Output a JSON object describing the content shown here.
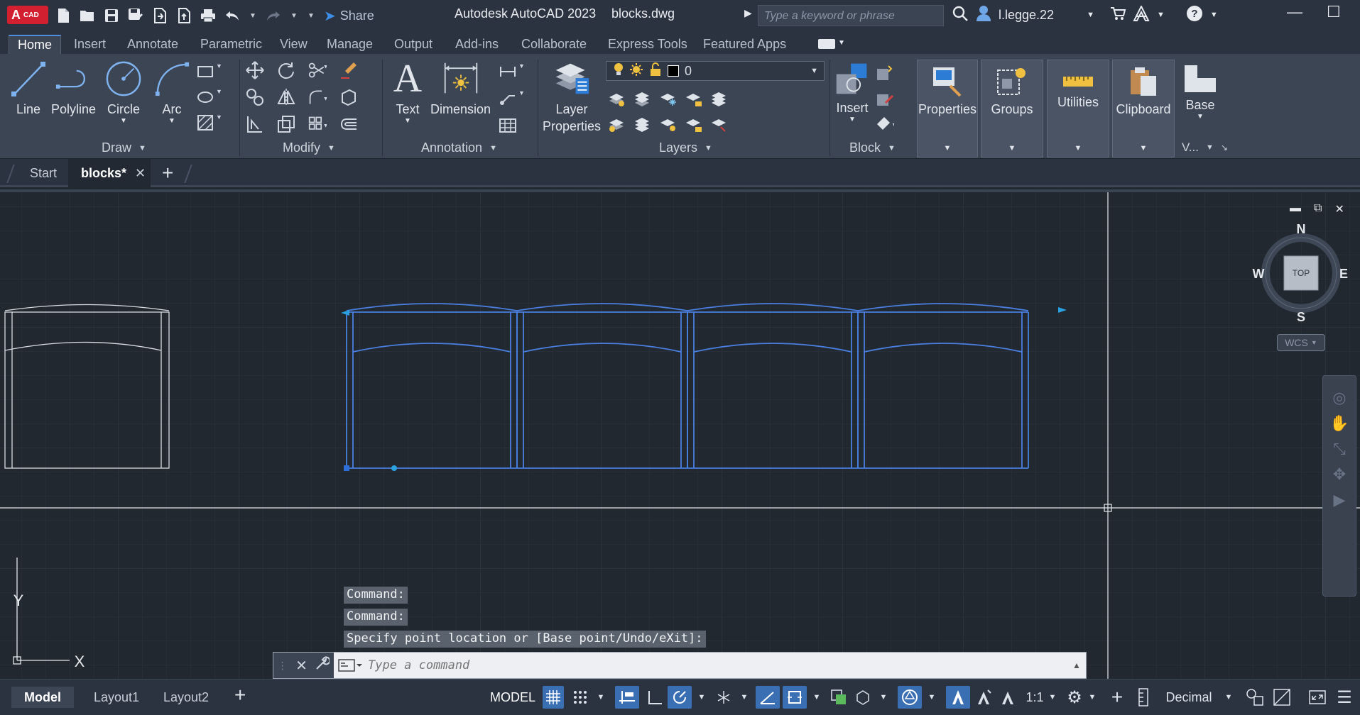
{
  "app": {
    "logo_letter": "A",
    "logo_suffix": "CAD",
    "title": "Autodesk AutoCAD 2023",
    "filename": "blocks.dwg",
    "share_label": "Share",
    "search_placeholder": "Type a keyword or phrase",
    "username": "l.legge.22"
  },
  "ribbon_tabs": [
    "Home",
    "Insert",
    "Annotate",
    "Parametric",
    "View",
    "Manage",
    "Output",
    "Add-ins",
    "Collaborate",
    "Express Tools",
    "Featured Apps"
  ],
  "ribbon": {
    "draw": {
      "title": "Draw",
      "tools": [
        "Line",
        "Polyline",
        "Circle",
        "Arc"
      ]
    },
    "modify": {
      "title": "Modify"
    },
    "annotation": {
      "title": "Annotation",
      "tools": [
        "Text",
        "Dimension"
      ]
    },
    "layers": {
      "title": "Layers",
      "layer_properties": [
        "Layer",
        "Properties"
      ],
      "current_layer": "0"
    },
    "block": {
      "title": "Block",
      "insert": "Insert"
    },
    "properties": "Properties",
    "groups": "Groups",
    "utilities": "Utilities",
    "clipboard": "Clipboard",
    "view": {
      "base": "Base",
      "title": "V..."
    }
  },
  "doc_tabs": {
    "start": "Start",
    "current": "blocks*"
  },
  "viewcube": {
    "north": "N",
    "south": "S",
    "east": "E",
    "west": "W",
    "face": "TOP",
    "wcs": "WCS"
  },
  "ucs": {
    "x": "X",
    "y": "Y"
  },
  "command": {
    "history": [
      "Command:",
      "Command:",
      "Specify point location or [Base point/Undo/eXit]:"
    ],
    "placeholder": "Type a command"
  },
  "layout_tabs": [
    "Model",
    "Layout1",
    "Layout2"
  ],
  "status": {
    "model": "MODEL",
    "scale": "1:1",
    "units": "Decimal"
  },
  "colors": {
    "accent": "#3c8ee6",
    "selected_block": "#4a7fe0",
    "logo": "#d22030"
  }
}
